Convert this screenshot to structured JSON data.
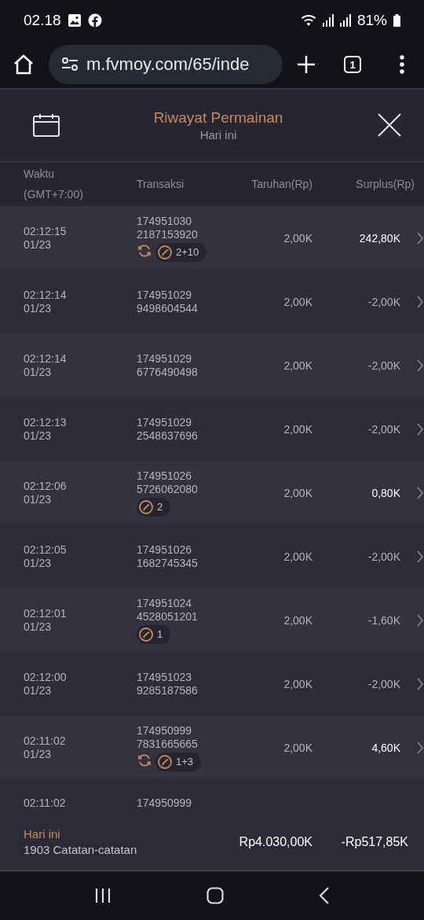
{
  "status_bar": {
    "time": "02.18",
    "battery": "81%"
  },
  "browser": {
    "url": "m.fvmoy.com/65/inde",
    "tab_count": "1"
  },
  "header": {
    "title": "Riwayat Permainan",
    "subtitle": "Hari ini"
  },
  "table": {
    "columns": [
      "Waktu\n(GMT+7:00)",
      "Transaksi",
      "Taruhan(Rp)",
      "Surplus(Rp)"
    ],
    "rows": [
      {
        "time": "02:12:15",
        "date": "01/23",
        "tx_1": "174951030",
        "tx_2": "2187153920",
        "respin": true,
        "free_spins": "2+10",
        "bet": "2,00K",
        "surplus": "242,80K",
        "positive": true
      },
      {
        "time": "02:12:14",
        "date": "01/23",
        "tx_1": "174951029",
        "tx_2": "9498604544",
        "respin": false,
        "bet": "2,00K",
        "surplus": "-2,00K",
        "positive": false
      },
      {
        "time": "02:12:14",
        "date": "01/23",
        "tx_1": "174951029",
        "tx_2": "6776490498",
        "respin": false,
        "bet": "2,00K",
        "surplus": "-2,00K",
        "positive": false
      },
      {
        "time": "02:12:13",
        "date": "01/23",
        "tx_1": "174951029",
        "tx_2": "2548637696",
        "respin": false,
        "bet": "2,00K",
        "surplus": "-2,00K",
        "positive": false
      },
      {
        "time": "02:12:06",
        "date": "01/23",
        "tx_1": "174951026",
        "tx_2": "5726062080",
        "respin": false,
        "free_spins": "2",
        "bet": "2,00K",
        "surplus": "0,80K",
        "positive": true
      },
      {
        "time": "02:12:05",
        "date": "01/23",
        "tx_1": "174951026",
        "tx_2": "1682745345",
        "respin": false,
        "bet": "2,00K",
        "surplus": "-2,00K",
        "positive": false
      },
      {
        "time": "02:12:01",
        "date": "01/23",
        "tx_1": "174951024",
        "tx_2": "4528051201",
        "respin": false,
        "free_spins": "1",
        "bet": "2,00K",
        "surplus": "-1,60K",
        "positive": false
      },
      {
        "time": "02:12:00",
        "date": "01/23",
        "tx_1": "174951023",
        "tx_2": "9285187586",
        "respin": false,
        "bet": "2,00K",
        "surplus": "-2,00K",
        "positive": false
      },
      {
        "time": "02:11:02",
        "date": "01/23",
        "tx_1": "174950999",
        "tx_2": "7831665665",
        "respin": true,
        "free_spins": "1+3",
        "bet": "2,00K",
        "surplus": "4,60K",
        "positive": true
      },
      {
        "time": "02:11:02",
        "tx_1": "174950999",
        "respin": false
      }
    ]
  },
  "footer": {
    "label": "Hari ini",
    "count": "1903 Catatan-catatan",
    "total_bet": "Rp4.030,00K",
    "total_surplus": "-Rp517,85K"
  }
}
